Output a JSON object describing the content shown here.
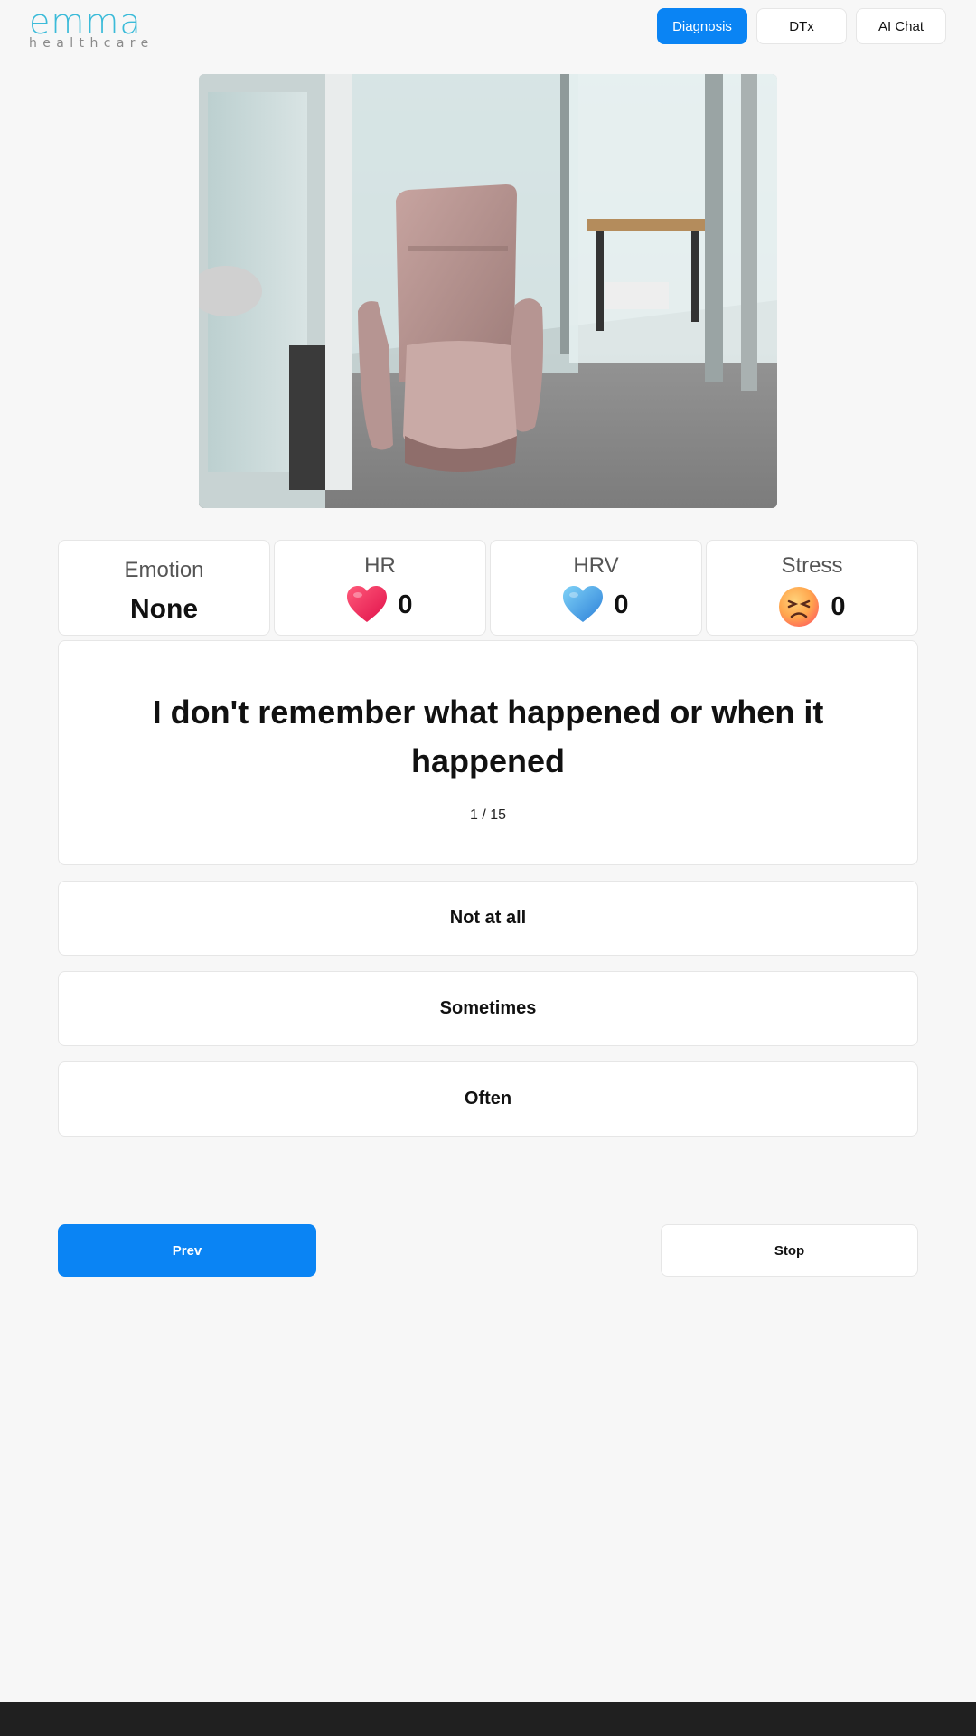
{
  "header": {
    "logo_main": "emma",
    "logo_sub": "healthcare",
    "nav": [
      {
        "label": "Diagnosis",
        "active": true
      },
      {
        "label": "DTx",
        "active": false
      },
      {
        "label": "AI Chat",
        "active": false
      }
    ]
  },
  "camera": {
    "description_icon": "camera-feed"
  },
  "metrics": {
    "emotion": {
      "label": "Emotion",
      "value": "None"
    },
    "hr": {
      "label": "HR",
      "value": "0",
      "icon": "red-heart-icon"
    },
    "hrv": {
      "label": "HRV",
      "value": "0",
      "icon": "blue-heart-icon"
    },
    "stress": {
      "label": "Stress",
      "value": "0",
      "icon": "stressed-face-icon"
    }
  },
  "question": {
    "text": "I don't remember what happened or when it happened",
    "progress": "1 / 15"
  },
  "answers": [
    "Not at all",
    "Sometimes",
    "Often"
  ],
  "controls": {
    "prev": "Prev",
    "stop": "Stop"
  },
  "colors": {
    "accent": "#0a84f4",
    "logo": "#3bbbd9",
    "footer": "#202020"
  }
}
